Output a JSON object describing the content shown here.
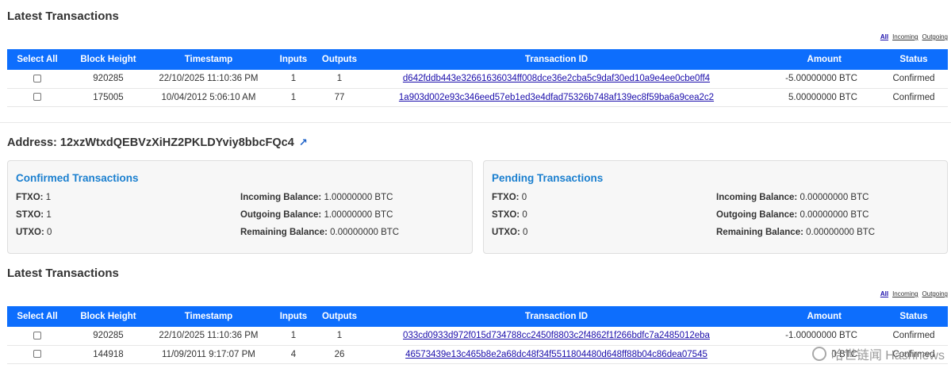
{
  "section1": {
    "title": "Latest Transactions",
    "filters": [
      "All",
      "Incoming",
      "Outgoing"
    ],
    "columns": [
      "Select All",
      "Block Height",
      "Timestamp",
      "Inputs",
      "Outputs",
      "Transaction ID",
      "Amount",
      "Status"
    ],
    "rows": [
      {
        "block": "920285",
        "time": "22/10/2025 11:10:36 PM",
        "inputs": "1",
        "outputs": "1",
        "txid": "d642fddb443e32661636034ff008dce36e2cba5c9daf30ed10a9e4ee0cbe0ff4",
        "amount": "-5.00000000 BTC",
        "status": "Confirmed"
      },
      {
        "block": "175005",
        "time": "10/04/2012 5:06:10 AM",
        "inputs": "1",
        "outputs": "77",
        "txid": "1a903d002e93c346eed57eb1ed3e4dfad75326b748af139ec8f59ba6a9cea2c2",
        "amount": "5.00000000 BTC",
        "status": "Confirmed"
      }
    ]
  },
  "address": {
    "label": "Address: 12xzWtxdQEBVzXiHZ2PKLDYviy8bbcFQc4",
    "link_icon": "external-link-icon"
  },
  "confirmed": {
    "title": "Confirmed Transactions",
    "ftxo_label": "FTXO:",
    "ftxo": "1",
    "stxo_label": "STXO:",
    "stxo": "1",
    "utxo_label": "UTXO:",
    "utxo": "0",
    "incoming_label": "Incoming Balance:",
    "incoming": "1.00000000 BTC",
    "outgoing_label": "Outgoing Balance:",
    "outgoing": "1.00000000 BTC",
    "remaining_label": "Remaining Balance:",
    "remaining": "0.00000000 BTC"
  },
  "pending": {
    "title": "Pending Transactions",
    "ftxo_label": "FTXO:",
    "ftxo": "0",
    "stxo_label": "STXO:",
    "stxo": "0",
    "utxo_label": "UTXO:",
    "utxo": "0",
    "incoming_label": "Incoming Balance:",
    "incoming": "0.00000000 BTC",
    "outgoing_label": "Outgoing Balance:",
    "outgoing": "0.00000000 BTC",
    "remaining_label": "Remaining Balance:",
    "remaining": "0.00000000 BTC"
  },
  "section2": {
    "title": "Latest Transactions",
    "filters": [
      "All",
      "Incoming",
      "Outgoing"
    ],
    "columns": [
      "Select All",
      "Block Height",
      "Timestamp",
      "Inputs",
      "Outputs",
      "Transaction ID",
      "Amount",
      "Status"
    ],
    "rows": [
      {
        "block": "920285",
        "time": "22/10/2025 11:10:36 PM",
        "inputs": "1",
        "outputs": "1",
        "txid": "033cd0933d972f015d734788cc2450f8803c2f4862f1f266bdfc7a2485012eba",
        "amount": "-1.00000000 BTC",
        "status": "Confirmed"
      },
      {
        "block": "144918",
        "time": "11/09/2011 9:17:07 PM",
        "inputs": "4",
        "outputs": "26",
        "txid": "46573439e13c465b8e2a68dc48f34f5511804480d648ff88b04c86dea07545",
        "amount": "0 BTC",
        "status": "Confirmed"
      }
    ]
  },
  "watermark": "哈世链闻 Hashnews",
  "colors": {
    "header_blue": "#0d6efd",
    "card_title": "#1a7fcf",
    "link": "#1a0dab"
  }
}
